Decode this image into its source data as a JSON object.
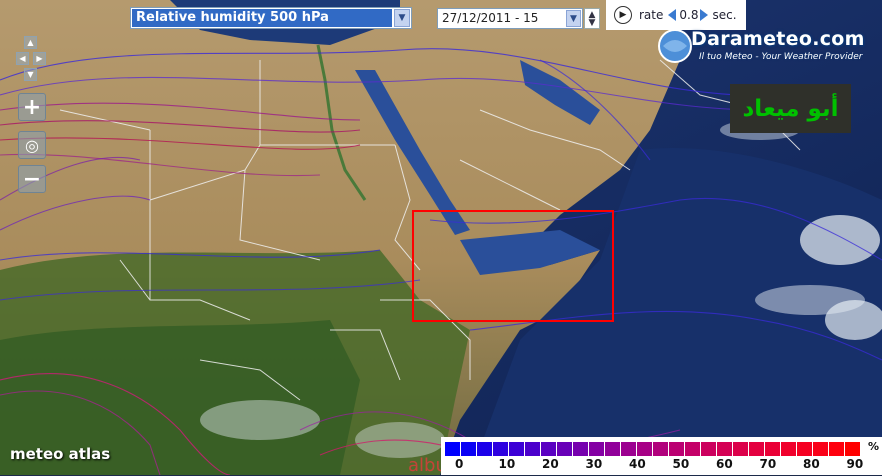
{
  "toolbar": {
    "parameter_value": "Relative humidity 500 hPa",
    "date_value": "27/12/2011 - 15",
    "rate_label": "rate",
    "rate_value": "0.8",
    "rate_unit": "sec."
  },
  "branding": {
    "site_name": "Darameteo.com",
    "tagline": "Il tuo Meteo - Your Weather Provider",
    "arabic_overlay": "أبو ميعاد",
    "atlas_logo": "meteo atlas",
    "watermark": "alburi.com"
  },
  "legend": {
    "unit": "%",
    "labels": [
      "0",
      "10",
      "20",
      "30",
      "40",
      "50",
      "60",
      "70",
      "80",
      "90"
    ],
    "colors": [
      "#0000ff",
      "#0a00f5",
      "#1c00ea",
      "#2e00e0",
      "#3c00d6",
      "#4b00cc",
      "#5a00c2",
      "#6800b8",
      "#7600ae",
      "#8400a4",
      "#91009a",
      "#9c0090",
      "#a70086",
      "#b1007c",
      "#bb0072",
      "#c40068",
      "#cc005e",
      "#d40054",
      "#dc004a",
      "#e40040",
      "#ea0036",
      "#f0002c",
      "#f50022",
      "#fa0018",
      "#ff000e",
      "#ff0000"
    ]
  },
  "highlight": {
    "color": "#ff0000"
  }
}
